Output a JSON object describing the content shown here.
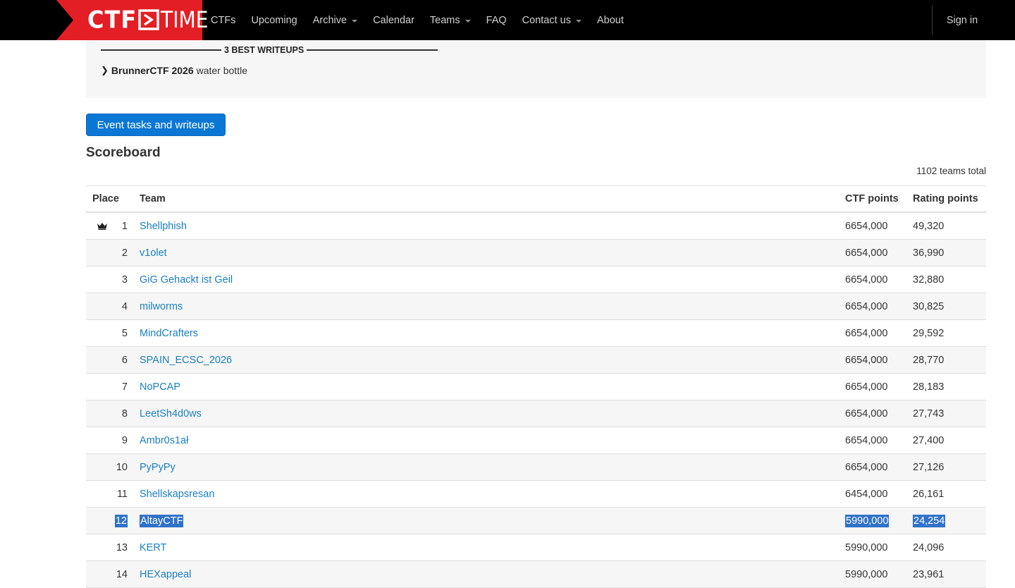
{
  "nav": {
    "brand_left": "CTF",
    "brand_right": "TIME",
    "colors": {
      "background": "#000000",
      "brand_red": "#e31e24",
      "link": "#d0d0d0"
    },
    "items": [
      {
        "label": "CTFs",
        "dropdown": false
      },
      {
        "label": "Upcoming",
        "dropdown": false
      },
      {
        "label": "Archive",
        "dropdown": true
      },
      {
        "label": "Calendar",
        "dropdown": false
      },
      {
        "label": "Teams",
        "dropdown": true
      },
      {
        "label": "FAQ",
        "dropdown": false
      },
      {
        "label": "Contact us",
        "dropdown": true
      },
      {
        "label": "About",
        "dropdown": false
      }
    ],
    "signin": "Sign in"
  },
  "writeups": {
    "heading": "3 BEST WRITEUPS",
    "items": [
      {
        "event": "BrunnerCTF 2026",
        "title": "water bottle"
      }
    ]
  },
  "tasks_button": "Event tasks and writeups",
  "scoreboard": {
    "title": "Scoreboard",
    "teams_total": "1102 teams total",
    "columns": {
      "place": "Place",
      "team": "Team",
      "ctf_points": "CTF points",
      "rating_points": "Rating points"
    },
    "winner_icon": "crown-icon",
    "rows": [
      {
        "place": "1",
        "team": "Shellphish",
        "ctf_points": "6654,000",
        "rating_points": "49,320"
      },
      {
        "place": "2",
        "team": "v1olet",
        "ctf_points": "6654,000",
        "rating_points": "36,990"
      },
      {
        "place": "3",
        "team": "GiG Gehackt ist Geil",
        "ctf_points": "6654,000",
        "rating_points": "32,880"
      },
      {
        "place": "4",
        "team": "milworms",
        "ctf_points": "6654,000",
        "rating_points": "30,825"
      },
      {
        "place": "5",
        "team": "MindCrafters",
        "ctf_points": "6654,000",
        "rating_points": "29,592"
      },
      {
        "place": "6",
        "team": "SPAIN_ECSC_2026",
        "ctf_points": "6654,000",
        "rating_points": "28,770"
      },
      {
        "place": "7",
        "team": "NoPCAP",
        "ctf_points": "6654,000",
        "rating_points": "28,183"
      },
      {
        "place": "8",
        "team": "LeetSh4d0ws",
        "ctf_points": "6654,000",
        "rating_points": "27,743"
      },
      {
        "place": "9",
        "team": "Ambr0s1ał",
        "ctf_points": "6654,000",
        "rating_points": "27,400"
      },
      {
        "place": "10",
        "team": "PyPyPy",
        "ctf_points": "6654,000",
        "rating_points": "27,126"
      },
      {
        "place": "11",
        "team": "Shellskapsresan",
        "ctf_points": "6454,000",
        "rating_points": "26,161"
      },
      {
        "place": "12",
        "team": "AltayCTF",
        "ctf_points": "5990,000",
        "rating_points": "24,254",
        "selected": true
      },
      {
        "place": "13",
        "team": "KERT",
        "ctf_points": "5990,000",
        "rating_points": "24,096"
      },
      {
        "place": "14",
        "team": "HEXappeal",
        "ctf_points": "5990,000",
        "rating_points": "23,961"
      }
    ],
    "selection_color": "#3072c9",
    "link_color": "#1a7fc0"
  }
}
